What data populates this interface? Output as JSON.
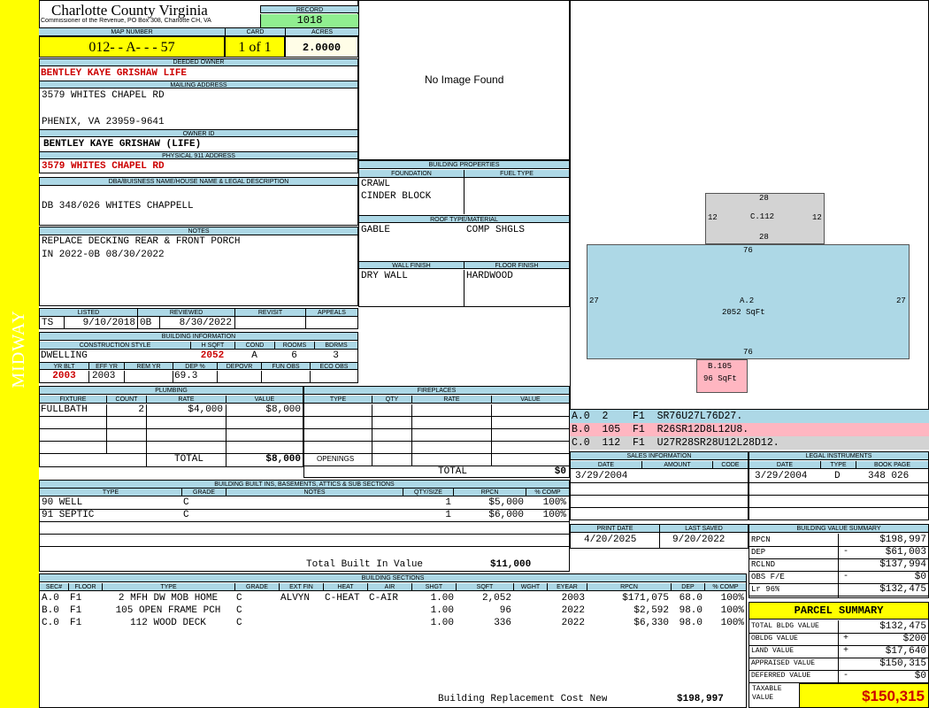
{
  "side_label": "MIDWAY",
  "header": {
    "county": "Charlotte County Virginia",
    "commissioner": "Commissioner of the Revenue, PO Box 308, Charlotte CH, VA",
    "record_label": "RECORD",
    "record": "1018"
  },
  "map": {
    "map_label": "MAP NUMBER",
    "map_number": "012- - A- - - 57",
    "card_label": "CARD",
    "card": "1 of 1",
    "acres_label": "ACRES",
    "acres": "2.0000"
  },
  "owner": {
    "deeded_label": "DEEDED OWNER",
    "deeded": "BENTLEY KAYE GRISHAW LIFE",
    "mailing_label": "MAILING ADDRESS",
    "mail1": "3579 WHITES CHAPEL RD",
    "mail2": "PHENIX, VA 23959-9641",
    "owner_id_label": "OWNER ID",
    "owner_id": "BENTLEY KAYE GRISHAW (LIFE)",
    "phys_label": "PHYSICAL 911 ADDRESS",
    "phys": "3579 WHITES CHAPEL RD"
  },
  "legal": {
    "label": "DBA/BUISNESS NAME/HOUSE NAME & LEGAL DESCRIPTION",
    "text": "DB 348/026 WHITES CHAPPELL"
  },
  "notes": {
    "label": "NOTES",
    "line1": "REPLACE DECKING REAR & FRONT PORCH",
    "line2": "IN 2022-0B 08/30/2022"
  },
  "listed": {
    "listed_label": "LISTED",
    "reviewed_label": "REVIEWED",
    "revisit_label": "REVISIT",
    "appeals_label": "APPEALS",
    "listed_by": "TS",
    "listed_date": "9/10/2018",
    "reviewed_by": "0B",
    "reviewed_date": "8/30/2022"
  },
  "building_info": {
    "label": "BUILDING INFORMATION",
    "style_label": "CONSTRUCTION STYLE",
    "hsqft_label": "H SQFT",
    "cond_label": "COND",
    "rooms_label": "ROOMS",
    "bdrms_label": "BDRMS",
    "style": "DWELLING",
    "hsqft": "2052",
    "cond": "A",
    "rooms": "6",
    "bdrms": "3",
    "yrblt_label": "YR BLT",
    "effyr_label": "EFF YR",
    "remyr_label": "REM YR",
    "dep_label": "DEP %",
    "depovr_label": "DEPOVR",
    "funobs_label": "FUN OBS",
    "ecoobs_label": "ECO OBS",
    "yrblt": "2003",
    "effyr": "2003",
    "dep": "69.3"
  },
  "no_image": "No Image Found",
  "building_props": {
    "label": "BUILDING PROPERTIES",
    "foundation_label": "FOUNDATION",
    "fuel_label": "FUEL TYPE",
    "found1": "CRAWL",
    "found2": "CINDER BLOCK",
    "roof_label": "ROOF TYPE/MATERIAL",
    "roof1": "GABLE",
    "roof2": "COMP SHGLS",
    "wall_label": "WALL FINISH",
    "floor_label": "FLOOR FINISH",
    "wall": "DRY WALL",
    "floor": "HARDWOOD"
  },
  "sketch": {
    "c_label": "C.112",
    "c_top": "28",
    "c_bottom": "28",
    "c_left": "12",
    "c_right": "12",
    "a_label": "A.2",
    "a_area": "2052 SqFt",
    "a_top": "76",
    "a_bottom": "76",
    "a_left": "27",
    "a_right": "27",
    "b_label": "B.105",
    "b_area": "96 SqFt"
  },
  "legend_rows": [
    "A.0  2    F1  SR76U27L76D27.",
    "B.0  105  F1  R26SR12D8L12U8.",
    "C.0  112  F1  U27R28SR28U12L28D12."
  ],
  "plumbing": {
    "label": "PLUMBING",
    "headers": [
      "FIXTURE",
      "COUNT",
      "RATE",
      "VALUE"
    ],
    "fixture": "FULLBATH",
    "count": "2",
    "rate": "$4,000",
    "value": "$8,000",
    "total_label": "TOTAL",
    "total": "$8,000"
  },
  "fireplaces": {
    "label": "FIREPLACES",
    "headers": [
      "TYPE",
      "QTY",
      "RATE",
      "VALUE"
    ],
    "openings": "OPENINGS",
    "total_label": "TOTAL",
    "total": "$0"
  },
  "builtins": {
    "label": "BUILDING BUILT INS, BASEMENTS, ATTICS & SUB SECTIONS",
    "headers": [
      "TYPE",
      "GRADE",
      "NOTES",
      "QTY/SIZE",
      "RPCN",
      "% COMP"
    ],
    "rows": [
      [
        "90 WELL",
        "C",
        "",
        "1",
        "$5,000",
        "100%"
      ],
      [
        "91 SEPTIC",
        "C",
        "",
        "1",
        "$6,000",
        "100%"
      ]
    ],
    "total_label": "Total Built In Value",
    "total": "$11,000"
  },
  "sections": {
    "label": "BUILDING SECTIONS",
    "headers": [
      "SEC#",
      "FLOOR",
      "TYPE",
      "GRADE",
      "EXT FIN",
      "HEAT",
      "AIR",
      "SHGT",
      "SQFT",
      "WGHT",
      "EYEAR",
      "RPCN",
      "DEP",
      "% COMP"
    ],
    "rows": [
      [
        "A.0",
        "F1",
        "2 MFH DW MOB HOME",
        "C",
        "ALVYN",
        "C-HEAT",
        "C-AIR",
        "1.00",
        "2,052",
        "",
        "2003",
        "$171,075",
        "68.0",
        "100%"
      ],
      [
        "B.0",
        "F1",
        "105 OPEN FRAME PCH",
        "C",
        "",
        "",
        "",
        "1.00",
        "96",
        "",
        "2022",
        "$2,592",
        "98.0",
        "100%"
      ],
      [
        "C.0",
        "F1",
        "112 WOOD DECK",
        "C",
        "",
        "",
        "",
        "1.00",
        "336",
        "",
        "2022",
        "$6,330",
        "98.0",
        "100%"
      ]
    ],
    "rcn_label": "Building Replacement Cost New",
    "rcn": "$198,997"
  },
  "sales": {
    "label": "SALES INFORMATION",
    "headers": [
      "DATE",
      "AMOUNT",
      "CODE"
    ],
    "date": "3/29/2004"
  },
  "legal_inst": {
    "label": "LEGAL INSTRUMENTS",
    "headers": [
      "DATE",
      "TYPE",
      "BOOK PAGE"
    ],
    "date": "3/29/2004",
    "type": "D",
    "book": "348 026"
  },
  "print": {
    "print_label": "PRINT DATE",
    "saved_label": "LAST SAVED",
    "print_date": "4/20/2025",
    "saved_date": "9/20/2022"
  },
  "bvs": {
    "label": "BUILDING VALUE SUMMARY",
    "rows": [
      [
        "RPCN",
        "",
        "$198,997"
      ],
      [
        "DEP",
        "-",
        "$61,003"
      ],
      [
        "RCLND",
        "",
        "$137,994"
      ],
      [
        "OBS F/E",
        "-",
        "$0"
      ],
      [
        "Lr 96%",
        "",
        "$132,475"
      ]
    ]
  },
  "parcel": {
    "label": "PARCEL SUMMARY",
    "rows": [
      [
        "TOTAL BLDG VALUE",
        "",
        "$132,475"
      ],
      [
        "OBLDG VALUE",
        "+",
        "$200"
      ],
      [
        "LAND VALUE",
        "+",
        "$17,640"
      ],
      [
        "APPRAISED VALUE",
        "",
        "$150,315"
      ],
      [
        "DEFERRED VALUE",
        "-",
        "$0"
      ]
    ],
    "taxable_label": "TAXABLE VALUE",
    "taxable": "$150,315"
  },
  "colors": {
    "header_blue": "#add8e6",
    "highlight_yellow": "#ffff00",
    "record_green": "#90ee90",
    "sketch_a": "#add8e6",
    "sketch_b": "#ffb6c1",
    "sketch_c": "#d3d3d3"
  }
}
